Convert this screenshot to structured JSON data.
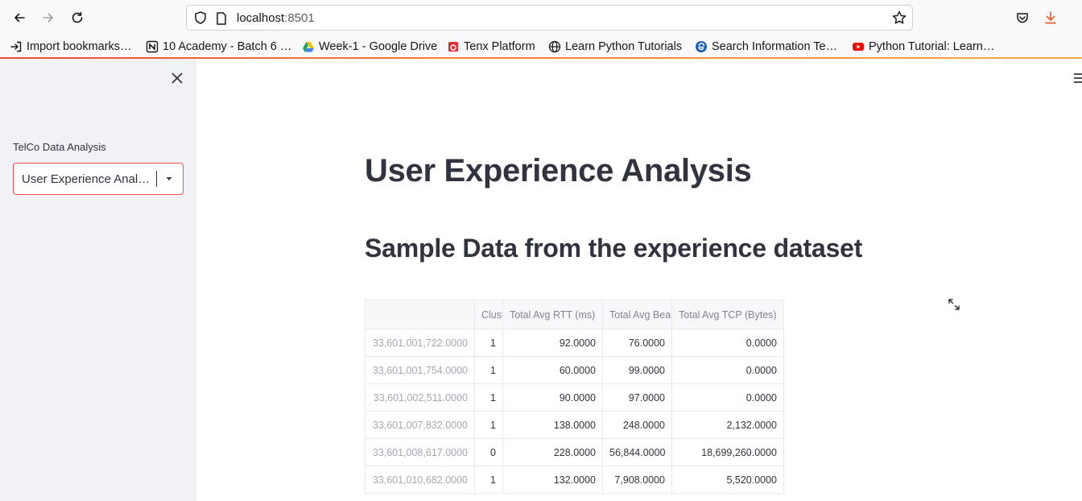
{
  "browser": {
    "url_host": "localhost",
    "url_port": ":8501",
    "bookmarks": [
      {
        "label": "Import bookmarks…",
        "icon": "import-icon"
      },
      {
        "label": "10 Academy - Batch 6 …",
        "icon": "notion-icon"
      },
      {
        "label": "Week-1 - Google Drive",
        "icon": "google-drive-icon"
      },
      {
        "label": "Tenx Platform",
        "icon": "tenx-icon"
      },
      {
        "label": "Learn Python Tutorials",
        "icon": "globe-icon"
      },
      {
        "label": "Search Information Te…",
        "icon": "edge-icon"
      },
      {
        "label": "Python Tutorial: Learn…",
        "icon": "youtube-icon"
      }
    ]
  },
  "sidebar": {
    "label": "TelCo Data Analysis",
    "select_value": "User Experience Analysis"
  },
  "main": {
    "title": "User Experience Analysis",
    "subtitle": "Sample Data from the experience dataset"
  },
  "table": {
    "columns": [
      "",
      "Cluster",
      "Total Avg RTT (ms)",
      "Total Avg Bearer TP (kbps)",
      "Total Avg TCP (Bytes)"
    ],
    "rows": [
      {
        "index": "33,601,001,722.0000",
        "cluster": "1",
        "rtt": "92.0000",
        "bearer": "76.0000",
        "tcp": "0.0000"
      },
      {
        "index": "33,601,001,754.0000",
        "cluster": "1",
        "rtt": "60.0000",
        "bearer": "99.0000",
        "tcp": "0.0000"
      },
      {
        "index": "33,601,002,511.0000",
        "cluster": "1",
        "rtt": "90.0000",
        "bearer": "97.0000",
        "tcp": "0.0000"
      },
      {
        "index": "33,601,007,832.0000",
        "cluster": "1",
        "rtt": "138.0000",
        "bearer": "248.0000",
        "tcp": "2,132.0000"
      },
      {
        "index": "33,601,008,617.0000",
        "cluster": "0",
        "rtt": "228.0000",
        "bearer": "56,844.0000",
        "tcp": "18,699,260.0000"
      },
      {
        "index": "33,601,010,682.0000",
        "cluster": "1",
        "rtt": "132.0000",
        "bearer": "7,908.0000",
        "tcp": "5,520.0000"
      }
    ]
  },
  "colors": {
    "accent": "#ff4b4b",
    "sidebar_bg": "#f0f2f6",
    "text": "#31333f"
  }
}
